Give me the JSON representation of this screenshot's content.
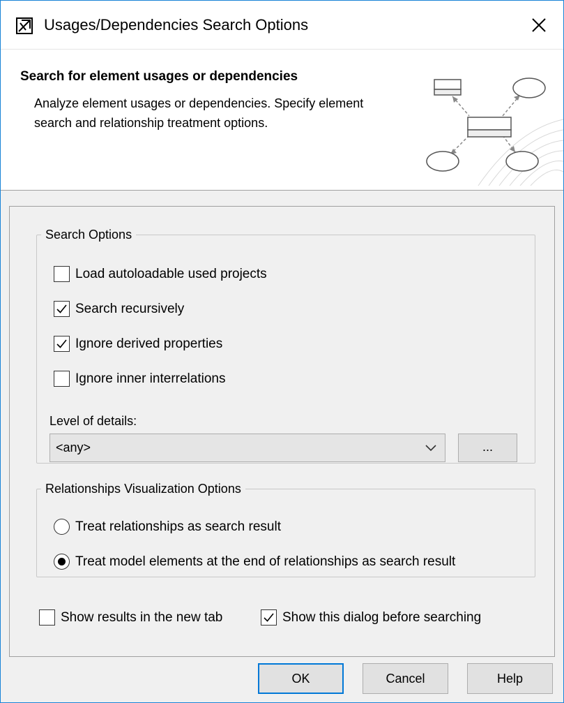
{
  "window": {
    "title": "Usages/Dependencies Search Options"
  },
  "banner": {
    "title": "Search for element usages or dependencies",
    "description": "Analyze element usages or dependencies. Specify element search and relationship treatment options."
  },
  "search_options": {
    "legend": "Search Options",
    "checkboxes": [
      {
        "label": "Load autoloadable used projects",
        "checked": false
      },
      {
        "label": "Search recursively",
        "checked": true
      },
      {
        "label": "Ignore derived properties",
        "checked": true
      },
      {
        "label": "Ignore inner interrelations",
        "checked": false
      }
    ],
    "level_label": "Level of details:",
    "level_value": "<any>",
    "more_label": "..."
  },
  "relationships": {
    "legend": "Relationships Visualization Options",
    "radios": [
      {
        "label": "Treat relationships as search result",
        "selected": false
      },
      {
        "label": "Treat model elements at the end of relationships as search result",
        "selected": true
      }
    ]
  },
  "bottom_options": [
    {
      "label": "Show results in the new tab",
      "checked": false
    },
    {
      "label": "Show this dialog before searching",
      "checked": true
    }
  ],
  "buttons": {
    "ok": "OK",
    "cancel": "Cancel",
    "help": "Help"
  },
  "colors": {
    "accent": "#0078d7",
    "window_border": "#1883d7"
  }
}
